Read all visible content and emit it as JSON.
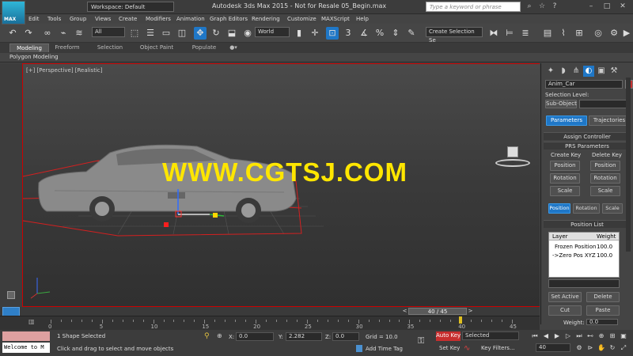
{
  "titlebar": {
    "logo": "MAX",
    "workspace": "Workspace: Default",
    "title": "Autodesk 3ds Max  2015   - Not for Resale    05_Begin.max",
    "search_placeholder": "Type a keyword or phrase"
  },
  "menu": [
    "Edit",
    "Tools",
    "Group",
    "Views",
    "Create",
    "Modifiers",
    "Animation",
    "Graph Editors",
    "Rendering",
    "Customize",
    "MAXScript",
    "Help"
  ],
  "toolbar": {
    "filter_value": "All",
    "coord_value": "World",
    "selection_set": "Create Selection Se",
    "snap_value": "3",
    "angle_snap": "%"
  },
  "ribbon": {
    "tabs": [
      "Modeling",
      "Freeform",
      "Selection",
      "Object Paint",
      "Populate"
    ],
    "active": "Modeling",
    "sub_label": "Polygon Modeling"
  },
  "viewport": {
    "label": "[+] [Perspective] [Realistic]",
    "watermark": "WWW.CGTSJ.COM"
  },
  "command_panel": {
    "object_name": "Anim_Car",
    "object_color": "#c83232",
    "selection_level_label": "Selection Level:",
    "sub_object_label": "Sub-Object",
    "tabs": [
      "Parameters",
      "Trajectories"
    ],
    "assign_controller": "Assign Controller",
    "prs_parameters": "PRS Parameters",
    "create_key_label": "Create Key",
    "delete_key_label": "Delete Key",
    "key_buttons": [
      "Position",
      "Rotation",
      "Scale"
    ],
    "prs_tabs": [
      "Position",
      "Rotation",
      "Scale"
    ],
    "position_list": "Position List",
    "list_headers": [
      "Layer",
      "Weight"
    ],
    "list_rows": [
      {
        "layer": "Frozen Position",
        "weight": "100.0"
      },
      {
        "layer": "->Zero Pos XYZ",
        "weight": "100.0"
      }
    ],
    "set_active": "Set Active",
    "delete": "Delete",
    "cut": "Cut",
    "paste": "Paste",
    "weight_label": "Weight:",
    "weight_value": "0.0"
  },
  "timeline": {
    "frame": "40 / 45",
    "ticks": [
      "0",
      "5",
      "10",
      "15",
      "20",
      "25",
      "30",
      "35",
      "40",
      "45"
    ],
    "current": 40,
    "total": 45
  },
  "status": {
    "listener": "Welcome to M",
    "selected": "1 Shape Selected",
    "prompt": "Click and drag to select and move objects",
    "x_label": "X:",
    "x_value": "0.0",
    "y_label": "Y:",
    "y_value": "2.282",
    "z_label": "Z:",
    "z_value": "0.0",
    "grid": "Grid = 10.0",
    "add_time_tag": "Add Time Tag",
    "auto_key": "Auto Key",
    "selected_dropdown": "Selected",
    "set_key": "Set Key",
    "key_filters": "Key Filters...",
    "frame_field": "40"
  }
}
